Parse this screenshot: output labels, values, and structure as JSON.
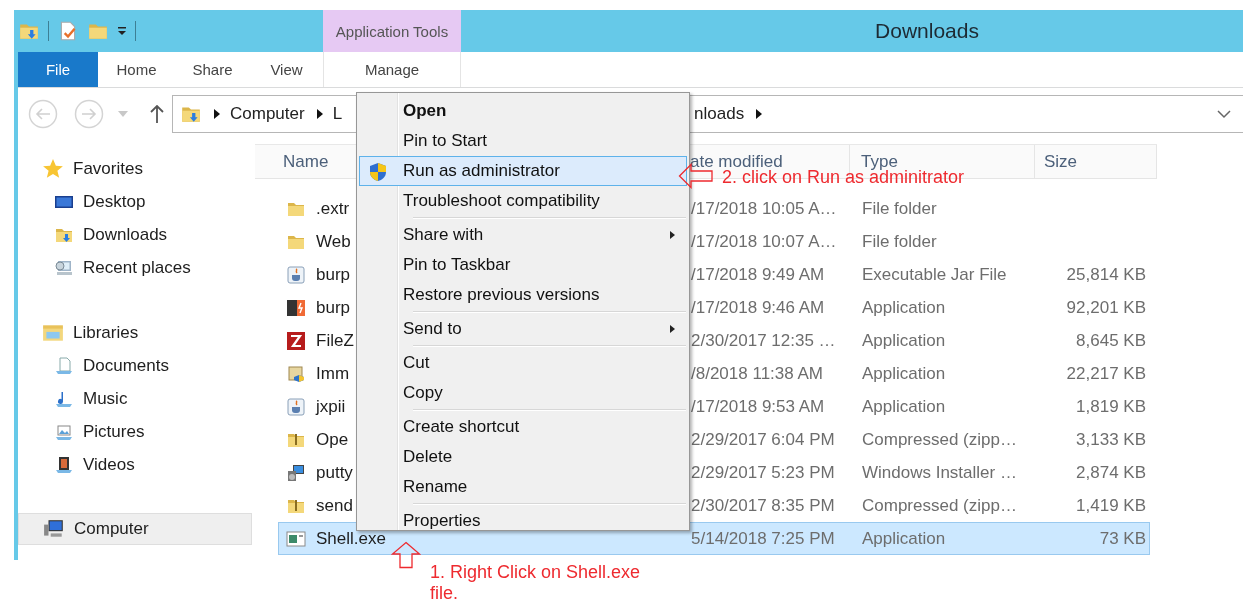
{
  "window": {
    "title": "Downloads"
  },
  "ribbon": {
    "contextual_group": "Application Tools",
    "tabs": [
      {
        "label": "File",
        "kind": "file",
        "selected": false
      },
      {
        "label": "Home",
        "kind": "tab",
        "selected": false
      },
      {
        "label": "Share",
        "kind": "tab",
        "selected": false
      },
      {
        "label": "View",
        "kind": "tab",
        "selected": false
      },
      {
        "label": "Manage",
        "kind": "contextual",
        "selected": false
      }
    ]
  },
  "address_bar": {
    "segments": [
      "Computer",
      "L",
      "nloads"
    ]
  },
  "sidebar": {
    "sections": [
      {
        "label": "Favorites",
        "selected": false,
        "items": [
          {
            "label": "Desktop",
            "selected": false
          },
          {
            "label": "Downloads",
            "selected": false
          },
          {
            "label": "Recent places",
            "selected": false
          }
        ]
      },
      {
        "label": "Libraries",
        "selected": false,
        "items": [
          {
            "label": "Documents",
            "selected": false
          },
          {
            "label": "Music",
            "selected": false
          },
          {
            "label": "Pictures",
            "selected": false
          },
          {
            "label": "Videos",
            "selected": false
          }
        ]
      },
      {
        "label": "Computer",
        "selected": true
      }
    ]
  },
  "file_list": {
    "columns": [
      "Name",
      "ate modified",
      "Type",
      "Size"
    ],
    "rows": [
      {
        "name": ".extr",
        "date": "/17/2018 10:05 A…",
        "type": "File folder",
        "selected": false
      },
      {
        "name": "Web",
        "date": "/17/2018 10:07 A…",
        "type": "File folder",
        "selected": false
      },
      {
        "name": "burp",
        "date": "/17/2018 9:49 AM",
        "type": "Executable Jar File",
        "size": "25,814 KB",
        "selected": false
      },
      {
        "name": "burp",
        "date": "/17/2018 9:46 AM",
        "type": "Application",
        "size": "92,201 KB",
        "selected": false
      },
      {
        "name": "FileZ",
        "date": "2/30/2017 12:35 …",
        "type": "Application",
        "size": "8,645 KB",
        "selected": false
      },
      {
        "name": "Imm",
        "date": "/8/2018 11:38 AM",
        "type": "Application",
        "size": "22,217 KB",
        "selected": false
      },
      {
        "name": "jxpii",
        "date": "/17/2018 9:53 AM",
        "type": "Application",
        "size": "1,819 KB",
        "selected": false
      },
      {
        "name": "Ope",
        "date": "2/29/2017 6:04 PM",
        "type": "Compressed (zipp…",
        "size": "3,133 KB",
        "selected": false
      },
      {
        "name": "putty",
        "date": "2/29/2017 5:23 PM",
        "type": "Windows Installer …",
        "size": "2,874 KB",
        "selected": false
      },
      {
        "name": "send",
        "date": "2/30/2017 8:35 PM",
        "type": "Compressed (zipp…",
        "size": "1,419 KB",
        "selected": false
      },
      {
        "name": "Shell.exe",
        "date": "5/14/2018 7:25 PM",
        "type": "Application",
        "size": "73 KB",
        "selected": true
      }
    ]
  },
  "context_menu": {
    "groups": [
      [
        {
          "label": "Open",
          "kind": "default",
          "selected": false
        },
        {
          "label": "Pin to Start",
          "kind": "plain",
          "selected": false
        },
        {
          "label": "Run as administrator",
          "kind": "elevated",
          "selected": true
        },
        {
          "label": "Troubleshoot compatibility",
          "kind": "plain",
          "selected": false
        }
      ],
      [
        {
          "label": "Share with",
          "kind": "submenu",
          "selected": false
        },
        {
          "label": "Pin to Taskbar",
          "kind": "plain",
          "selected": false
        },
        {
          "label": "Restore previous versions",
          "kind": "plain",
          "selected": false
        }
      ],
      [
        {
          "label": "Send to",
          "kind": "submenu",
          "selected": false
        }
      ],
      [
        {
          "label": "Cut",
          "kind": "plain",
          "selected": false
        },
        {
          "label": "Copy",
          "kind": "plain",
          "selected": false
        }
      ],
      [
        {
          "label": "Create shortcut",
          "kind": "plain",
          "selected": false
        },
        {
          "label": "Delete",
          "kind": "plain",
          "selected": false
        },
        {
          "label": "Rename",
          "kind": "plain",
          "selected": false
        }
      ],
      [
        {
          "label": "Properties",
          "kind": "plain",
          "selected": false
        }
      ]
    ]
  },
  "annotations": [
    {
      "kind": "left-arrow",
      "text": "2. click on Run as adminitrator"
    },
    {
      "kind": "up-arrow",
      "text": "1. Right Click on Shell.exe file."
    }
  ]
}
